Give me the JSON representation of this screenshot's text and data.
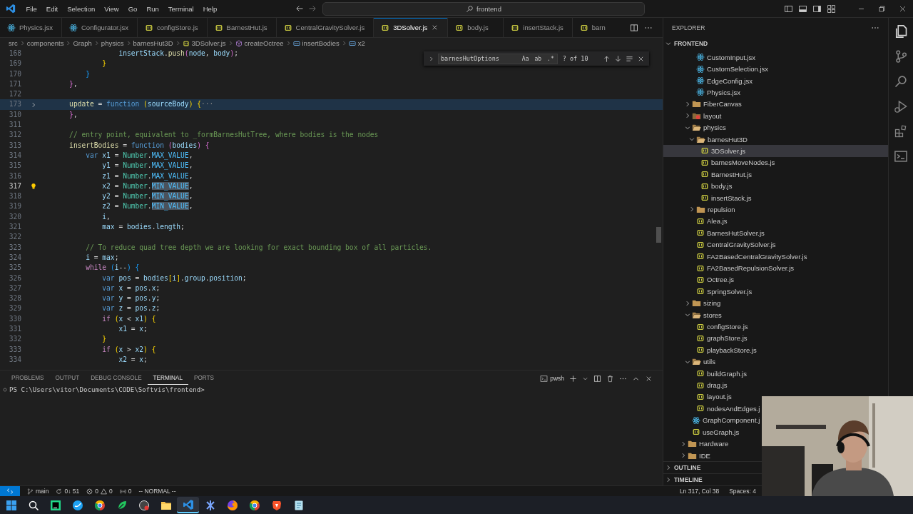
{
  "title_bar": {
    "menus": [
      "File",
      "Edit",
      "Selection",
      "View",
      "Go",
      "Run",
      "Terminal",
      "Help"
    ],
    "command_center": "frontend"
  },
  "editor": {
    "tabs": [
      {
        "label": "Physics.jsx",
        "kind": "jsx",
        "selected": false
      },
      {
        "label": "Configurator.jsx",
        "kind": "jsx",
        "selected": false
      },
      {
        "label": "configStore.js",
        "kind": "js",
        "selected": false
      },
      {
        "label": "BarnestHut.js",
        "kind": "js",
        "selected": false
      },
      {
        "label": "CentralGravitySolver.js",
        "kind": "js",
        "selected": false
      },
      {
        "label": "3DSolver.js",
        "kind": "js",
        "selected": true
      },
      {
        "label": "body.js",
        "kind": "js",
        "selected": false
      },
      {
        "label": "insertStack.js",
        "kind": "js",
        "selected": false
      },
      {
        "label": "barn",
        "kind": "js",
        "selected": false
      }
    ],
    "breadcrumb": [
      {
        "label": "src",
        "kind": "folder"
      },
      {
        "label": "components",
        "kind": "folder"
      },
      {
        "label": "Graph",
        "kind": "folder"
      },
      {
        "label": "physics",
        "kind": "folder"
      },
      {
        "label": "barnesHut3D",
        "kind": "folder"
      },
      {
        "label": "3DSolver.js",
        "kind": "js"
      },
      {
        "label": "createOctree",
        "kind": "method"
      },
      {
        "label": "insertBodies",
        "kind": "variable"
      },
      {
        "label": "x2",
        "kind": "variable"
      }
    ],
    "find": {
      "query": "barnesHutOptions",
      "toggles": [
        {
          "label": "Aa",
          "selected": false
        },
        {
          "label": "ab",
          "selected": false
        },
        {
          "label": ".*",
          "selected": false
        }
      ],
      "result": "? of 10"
    },
    "lines": [
      {
        "number": "168",
        "folded": false,
        "current": false,
        "tokens": [
          {
            "kind": "var",
            "text": "                insertStack"
          },
          {
            "kind": "p",
            "text": "."
          },
          {
            "kind": "fn",
            "text": "push"
          },
          {
            "kind": "b2",
            "text": "("
          },
          {
            "kind": "var",
            "text": "node"
          },
          {
            "kind": "p",
            "text": ", "
          },
          {
            "kind": "var",
            "text": "body"
          },
          {
            "kind": "b2",
            "text": ")"
          },
          {
            "kind": "p",
            "text": ";"
          }
        ]
      },
      {
        "number": "169",
        "folded": false,
        "current": false,
        "tokens": [
          {
            "kind": "b1",
            "text": "            }"
          }
        ]
      },
      {
        "number": "170",
        "folded": false,
        "current": false,
        "tokens": [
          {
            "kind": "b3",
            "text": "        }"
          }
        ]
      },
      {
        "number": "171",
        "folded": false,
        "current": false,
        "tokens": [
          {
            "kind": "b2",
            "text": "    }"
          },
          {
            "kind": "p",
            "text": ","
          }
        ]
      },
      {
        "number": "172",
        "folded": false,
        "current": false
      },
      {
        "number": "173",
        "folded": true,
        "current": false,
        "tokens": [
          {
            "kind": "fn",
            "text": "    update"
          },
          {
            "kind": "p",
            "text": " = "
          },
          {
            "kind": "kw",
            "text": "function "
          },
          {
            "kind": "b1",
            "text": "("
          },
          {
            "kind": "var",
            "text": "sourceBody"
          },
          {
            "kind": "b1",
            "text": ") {"
          },
          {
            "kind": "fold",
            "text": "···"
          }
        ]
      },
      {
        "number": "310",
        "folded": false,
        "current": false,
        "tokens": [
          {
            "kind": "b2",
            "text": "    }"
          },
          {
            "kind": "p",
            "text": ","
          }
        ]
      },
      {
        "number": "311",
        "folded": false,
        "current": false
      },
      {
        "number": "312",
        "folded": false,
        "current": false,
        "tokens": [
          {
            "kind": "cm",
            "text": "    // entry point, equivalent to _formBarnesHutTree, where bodies is the nodes"
          }
        ]
      },
      {
        "number": "313",
        "folded": false,
        "current": false,
        "tokens": [
          {
            "kind": "fn",
            "text": "    insertBodies"
          },
          {
            "kind": "p",
            "text": " = "
          },
          {
            "kind": "kw",
            "text": "function "
          },
          {
            "kind": "b2",
            "text": "("
          },
          {
            "kind": "var",
            "text": "bodies"
          },
          {
            "kind": "b2",
            "text": ") {"
          }
        ]
      },
      {
        "number": "314",
        "folded": false,
        "current": false,
        "tokens": [
          {
            "kind": "kw",
            "text": "        var "
          },
          {
            "kind": "var",
            "text": "x1"
          },
          {
            "kind": "p",
            "text": " = "
          },
          {
            "kind": "cls",
            "text": "Number"
          },
          {
            "kind": "p",
            "text": "."
          },
          {
            "kind": "const",
            "text": "MAX_VALUE"
          },
          {
            "kind": "p",
            "text": ","
          }
        ]
      },
      {
        "number": "315",
        "folded": false,
        "current": false,
        "tokens": [
          {
            "kind": "var",
            "text": "            y1"
          },
          {
            "kind": "p",
            "text": " = "
          },
          {
            "kind": "cls",
            "text": "Number"
          },
          {
            "kind": "p",
            "text": "."
          },
          {
            "kind": "const",
            "text": "MAX_VALUE"
          },
          {
            "kind": "p",
            "text": ","
          }
        ]
      },
      {
        "number": "316",
        "folded": false,
        "current": false,
        "tokens": [
          {
            "kind": "var",
            "text": "            z1"
          },
          {
            "kind": "p",
            "text": " = "
          },
          {
            "kind": "cls",
            "text": "Number"
          },
          {
            "kind": "p",
            "text": "."
          },
          {
            "kind": "const",
            "text": "MAX_VALUE"
          },
          {
            "kind": "p",
            "text": ","
          }
        ]
      },
      {
        "number": "317",
        "folded": false,
        "current": true,
        "tokens": [
          {
            "kind": "var",
            "text": "            x2"
          },
          {
            "kind": "p",
            "text": " = "
          },
          {
            "kind": "cls",
            "text": "Number"
          },
          {
            "kind": "p",
            "text": "."
          },
          {
            "kind": "match",
            "text": "MIN_VALUE"
          },
          {
            "kind": "p",
            "text": ","
          }
        ]
      },
      {
        "number": "318",
        "folded": false,
        "current": false,
        "tokens": [
          {
            "kind": "var",
            "text": "            y2"
          },
          {
            "kind": "p",
            "text": " = "
          },
          {
            "kind": "cls",
            "text": "Number"
          },
          {
            "kind": "p",
            "text": "."
          },
          {
            "kind": "match",
            "text": "MIN_VALUE"
          },
          {
            "kind": "p",
            "text": ","
          }
        ]
      },
      {
        "number": "319",
        "folded": false,
        "current": false,
        "tokens": [
          {
            "kind": "var",
            "text": "            z2"
          },
          {
            "kind": "p",
            "text": " = "
          },
          {
            "kind": "cls",
            "text": "Number"
          },
          {
            "kind": "p",
            "text": "."
          },
          {
            "kind": "match",
            "text": "MIN_VALUE"
          },
          {
            "kind": "p",
            "text": ","
          }
        ]
      },
      {
        "number": "320",
        "folded": false,
        "current": false,
        "tokens": [
          {
            "kind": "var",
            "text": "            i"
          },
          {
            "kind": "p",
            "text": ","
          }
        ]
      },
      {
        "number": "321",
        "folded": false,
        "current": false,
        "tokens": [
          {
            "kind": "var",
            "text": "            max"
          },
          {
            "kind": "p",
            "text": " = "
          },
          {
            "kind": "var",
            "text": "bodies"
          },
          {
            "kind": "p",
            "text": "."
          },
          {
            "kind": "var",
            "text": "length"
          },
          {
            "kind": "p",
            "text": ";"
          }
        ]
      },
      {
        "number": "322",
        "folded": false,
        "current": false
      },
      {
        "number": "323",
        "folded": false,
        "current": false,
        "tokens": [
          {
            "kind": "cm",
            "text": "        // To reduce quad tree depth we are looking for exact bounding box of all particles."
          }
        ]
      },
      {
        "number": "324",
        "folded": false,
        "current": false,
        "tokens": [
          {
            "kind": "var",
            "text": "        i"
          },
          {
            "kind": "p",
            "text": " = "
          },
          {
            "kind": "var",
            "text": "max"
          },
          {
            "kind": "p",
            "text": ";"
          }
        ]
      },
      {
        "number": "325",
        "folded": false,
        "current": false,
        "tokens": [
          {
            "kind": "ctl",
            "text": "        while "
          },
          {
            "kind": "b3",
            "text": "("
          },
          {
            "kind": "var",
            "text": "i"
          },
          {
            "kind": "p",
            "text": "--"
          },
          {
            "kind": "b3",
            "text": ") {"
          }
        ]
      },
      {
        "number": "326",
        "folded": false,
        "current": false,
        "tokens": [
          {
            "kind": "kw",
            "text": "            var "
          },
          {
            "kind": "var",
            "text": "pos"
          },
          {
            "kind": "p",
            "text": " = "
          },
          {
            "kind": "var",
            "text": "bodies"
          },
          {
            "kind": "b1",
            "text": "["
          },
          {
            "kind": "var",
            "text": "i"
          },
          {
            "kind": "b1",
            "text": "]"
          },
          {
            "kind": "p",
            "text": "."
          },
          {
            "kind": "var",
            "text": "group"
          },
          {
            "kind": "p",
            "text": "."
          },
          {
            "kind": "var",
            "text": "position"
          },
          {
            "kind": "p",
            "text": ";"
          }
        ]
      },
      {
        "number": "327",
        "folded": false,
        "current": false,
        "tokens": [
          {
            "kind": "kw",
            "text": "            var "
          },
          {
            "kind": "var",
            "text": "x"
          },
          {
            "kind": "p",
            "text": " = "
          },
          {
            "kind": "var",
            "text": "pos"
          },
          {
            "kind": "p",
            "text": "."
          },
          {
            "kind": "var",
            "text": "x"
          },
          {
            "kind": "p",
            "text": ";"
          }
        ]
      },
      {
        "number": "328",
        "folded": false,
        "current": false,
        "tokens": [
          {
            "kind": "kw",
            "text": "            var "
          },
          {
            "kind": "var",
            "text": "y"
          },
          {
            "kind": "p",
            "text": " = "
          },
          {
            "kind": "var",
            "text": "pos"
          },
          {
            "kind": "p",
            "text": "."
          },
          {
            "kind": "var",
            "text": "y"
          },
          {
            "kind": "p",
            "text": ";"
          }
        ]
      },
      {
        "number": "329",
        "folded": false,
        "current": false,
        "tokens": [
          {
            "kind": "kw",
            "text": "            var "
          },
          {
            "kind": "var",
            "text": "z"
          },
          {
            "kind": "p",
            "text": " = "
          },
          {
            "kind": "var",
            "text": "pos"
          },
          {
            "kind": "p",
            "text": "."
          },
          {
            "kind": "var",
            "text": "z"
          },
          {
            "kind": "p",
            "text": ";"
          }
        ]
      },
      {
        "number": "330",
        "folded": false,
        "current": false,
        "tokens": [
          {
            "kind": "ctl",
            "text": "            if "
          },
          {
            "kind": "b1",
            "text": "("
          },
          {
            "kind": "var",
            "text": "x"
          },
          {
            "kind": "p",
            "text": " < "
          },
          {
            "kind": "var",
            "text": "x1"
          },
          {
            "kind": "b1",
            "text": ") {"
          }
        ]
      },
      {
        "number": "331",
        "folded": false,
        "current": false,
        "tokens": [
          {
            "kind": "var",
            "text": "                x1"
          },
          {
            "kind": "p",
            "text": " = "
          },
          {
            "kind": "var",
            "text": "x"
          },
          {
            "kind": "p",
            "text": ";"
          }
        ]
      },
      {
        "number": "332",
        "folded": false,
        "current": false,
        "tokens": [
          {
            "kind": "b1",
            "text": "            }"
          }
        ]
      },
      {
        "number": "333",
        "folded": false,
        "current": false,
        "tokens": [
          {
            "kind": "ctl",
            "text": "            if "
          },
          {
            "kind": "b1",
            "text": "("
          },
          {
            "kind": "var",
            "text": "x"
          },
          {
            "kind": "p",
            "text": " > "
          },
          {
            "kind": "var",
            "text": "x2"
          },
          {
            "kind": "b1",
            "text": ") {"
          }
        ]
      },
      {
        "number": "334",
        "folded": false,
        "current": false,
        "tokens": [
          {
            "kind": "var",
            "text": "                x2"
          },
          {
            "kind": "p",
            "text": " = "
          },
          {
            "kind": "var",
            "text": "x"
          },
          {
            "kind": "p",
            "text": ";"
          }
        ]
      }
    ]
  },
  "panel": {
    "tabs": [
      {
        "label": "PROBLEMS",
        "selected": false
      },
      {
        "label": "OUTPUT",
        "selected": false
      },
      {
        "label": "DEBUG CONSOLE",
        "selected": false
      },
      {
        "label": "TERMINAL",
        "selected": true
      },
      {
        "label": "PORTS",
        "selected": false
      }
    ],
    "shell": "pwsh",
    "terminal_lines": [
      "PS C:\\Users\\vitor\\Documents\\CODE\\Softvis\\frontend>"
    ]
  },
  "explorer": {
    "title": "EXPLORER",
    "root": {
      "label": "FRONTEND",
      "expanded": true
    },
    "tree": [
      {
        "children": [
          {
            "children": [
              {
                "label": "CustomInput.jsx",
                "kind": "jsx",
                "selected": false
              },
              {
                "label": "CustomSelection.jsx",
                "kind": "jsx",
                "selected": false
              },
              {
                "label": "EdgeConfig.jsx",
                "kind": "jsx",
                "selected": false
              },
              {
                "label": "Physics.jsx",
                "kind": "jsx",
                "selected": false
              }
            ]
          },
          {
            "label": "FiberCanvas",
            "kind": "folder",
            "expanded": false,
            "selected": false
          },
          {
            "label": "layout",
            "kind": "special-folder",
            "expanded": false,
            "selected": false
          },
          {
            "label": "physics",
            "kind": "folder",
            "expanded": true,
            "selected": false,
            "children": [
              {
                "label": "barnesHut3D",
                "kind": "folder",
                "expanded": true,
                "selected": false,
                "children": [
                  {
                    "label": "3DSolver.js",
                    "kind": "js",
                    "selected": true
                  },
                  {
                    "label": "barnesMoveNodes.js",
                    "kind": "js",
                    "selected": false
                  },
                  {
                    "label": "BarnestHut.js",
                    "kind": "js",
                    "selected": false
                  },
                  {
                    "label": "body.js",
                    "kind": "js",
                    "selected": false
                  },
                  {
                    "label": "insertStack.js",
                    "kind": "js",
                    "selected": false
                  }
                ]
              },
              {
                "label": "repulsion",
                "kind": "folder",
                "expanded": false,
                "selected": false
              },
              {
                "label": "Alea.js",
                "kind": "js",
                "selected": false
              },
              {
                "label": "BarnesHutSolver.js",
                "kind": "js",
                "selected": false
              },
              {
                "label": "CentralGravitySolver.js",
                "kind": "js",
                "selected": false
              },
              {
                "label": "FA2BasedCentralGravitySolver.js",
                "kind": "js",
                "selected": false
              },
              {
                "label": "FA2BasedRepulsionSolver.js",
                "kind": "js",
                "selected": false
              },
              {
                "label": "Octree.js",
                "kind": "js",
                "selected": false
              },
              {
                "label": "SpringSolver.js",
                "kind": "js",
                "selected": false
              }
            ]
          },
          {
            "label": "sizing",
            "kind": "folder",
            "expanded": false,
            "selected": false
          },
          {
            "label": "stores",
            "kind": "folder",
            "expanded": true,
            "selected": false,
            "children": [
              {
                "label": "configStore.js",
                "kind": "js",
                "selected": false
              },
              {
                "label": "graphStore.js",
                "kind": "js",
                "selected": false
              },
              {
                "label": "playbackStore.js",
                "kind": "js",
                "selected": false
              }
            ]
          },
          {
            "label": "utils",
            "kind": "folder",
            "expanded": true,
            "selected": false,
            "children": [
              {
                "label": "buildGraph.js",
                "kind": "js",
                "selected": false
              },
              {
                "label": "drag.js",
                "kind": "js",
                "selected": false
              },
              {
                "label": "layout.js",
                "kind": "js",
                "selected": false
              },
              {
                "label": "nodesAndEdges.j",
                "kind": "js",
                "selected": false
              }
            ]
          },
          {
            "label": "GraphComponent.j",
            "kind": "jsx",
            "selected": false
          },
          {
            "label": "useGraph.js",
            "kind": "js",
            "selected": false
          }
        ]
      },
      {
        "label": "Hardware",
        "kind": "folder",
        "expanded": false,
        "selected": false
      },
      {
        "label": "IDE",
        "kind": "folder",
        "expanded": false,
        "selected": false
      }
    ],
    "sections": [
      {
        "label": "OUTLINE",
        "expanded": false
      },
      {
        "label": "TIMELINE",
        "expanded": false
      }
    ]
  },
  "activity_bar": [
    {
      "kind": "explorer",
      "selected": true
    },
    {
      "kind": "source-control",
      "selected": false
    },
    {
      "kind": "search",
      "selected": false
    },
    {
      "kind": "run",
      "selected": false
    },
    {
      "kind": "extensions",
      "selected": false
    },
    {
      "kind": "terminal",
      "selected": false
    }
  ],
  "status_bar": {
    "left": [
      {
        "kind": "remote"
      },
      {
        "kind": "branch",
        "label": "main"
      },
      {
        "kind": "sync",
        "label": "0↓ 51"
      },
      {
        "kind": "problems",
        "errors": "0",
        "warnings": "0"
      },
      {
        "kind": "ports",
        "label": "0"
      },
      {
        "kind": "text",
        "label": "-- NORMAL --"
      }
    ],
    "right": [
      {
        "kind": "text",
        "label": "Ln 317, Col 38"
      },
      {
        "kind": "text",
        "label": "Spaces: 4"
      }
    ]
  },
  "taskbar": [
    {
      "kind": "start",
      "selected": false
    },
    {
      "kind": "search",
      "selected": false
    },
    {
      "kind": "square",
      "selected": false
    },
    {
      "kind": "bird",
      "selected": false
    },
    {
      "kind": "ring",
      "selected": false
    },
    {
      "kind": "leaf",
      "selected": false
    },
    {
      "kind": "bug",
      "selected": false
    },
    {
      "kind": "folder",
      "selected": false
    },
    {
      "kind": "editor",
      "selected": true
    },
    {
      "kind": "studio",
      "selected": false
    },
    {
      "kind": "fox",
      "selected": false
    },
    {
      "kind": "ring",
      "selected": false
    },
    {
      "kind": "shield",
      "selected": false
    },
    {
      "kind": "note",
      "selected": false
    }
  ]
}
